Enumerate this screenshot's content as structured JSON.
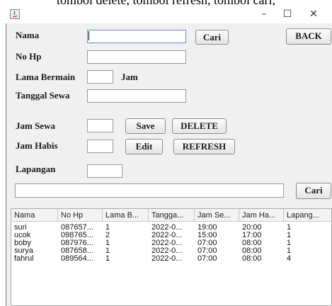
{
  "caption_fragment": "tombol delete, tombol refresh, tombol cari,",
  "window": {
    "icon": "java-app-icon",
    "controls": [
      "–",
      "☐",
      "✕"
    ]
  },
  "form": {
    "nama_label": "Nama",
    "nohp_label": "No Hp",
    "lama_label": "Lama Bermain",
    "jam_unit": "Jam",
    "tanggal_label": "Tanggal Sewa",
    "jam_sewa_label": "Jam Sewa",
    "jam_habis_label": "Jam Habis",
    "lapangan_label": "Lapangan",
    "nama_value": "",
    "nohp_value": "",
    "lama_value": "",
    "tanggal_value": "",
    "jam_sewa_value": "",
    "jam_habis_value": "",
    "lapangan_value": "",
    "search_value": ""
  },
  "buttons": {
    "cari_top": "Cari",
    "back": "BACK",
    "save": "Save",
    "delete": "DELETE",
    "edit": "Edit",
    "refresh": "REFRESH",
    "cari_bottom": "Cari"
  },
  "table": {
    "headers": [
      "Nama",
      "No Hp",
      "Lama B...",
      "Tangga...",
      "Jam Se...",
      "Jam Ha...",
      "Lapang..."
    ],
    "rows": [
      [
        "suri",
        "087657...",
        "1",
        "2022-0...",
        "19:00",
        "20:00",
        "1"
      ],
      [
        "ucok",
        "098765...",
        "2",
        "2022-0...",
        "15:00",
        "17:00",
        "1"
      ],
      [
        "boby",
        "087976...",
        "1",
        "2022-0...",
        "07:00",
        "08:00",
        "1"
      ],
      [
        "surya",
        "087658...",
        "1",
        "2022-0...",
        "07:00",
        "08:00",
        "1"
      ],
      [
        "fahrul",
        "089564...",
        "1",
        "2022-0...",
        "07:00",
        "08:00",
        "4"
      ]
    ]
  }
}
